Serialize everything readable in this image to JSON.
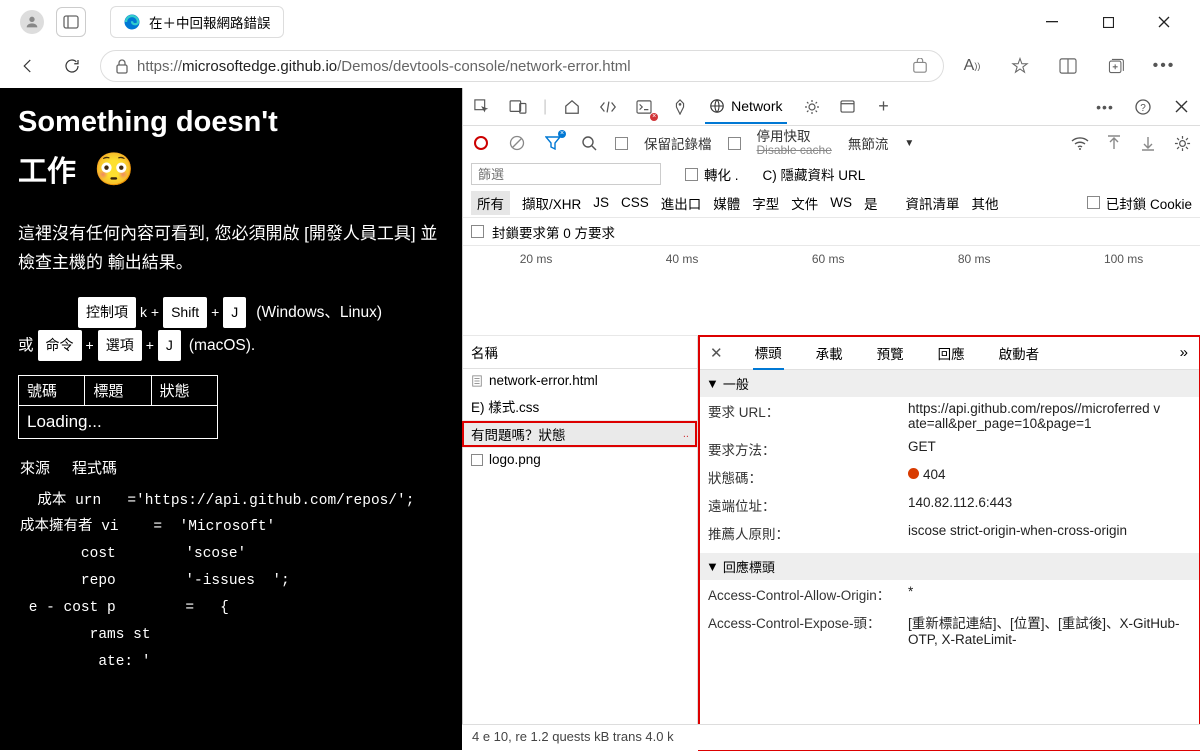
{
  "window": {
    "tab_title": "在＋中回報網路錯誤",
    "url_prefix": "https://",
    "url_host": "microsoftedge.github.io",
    "url_path": "/Demos/devtools-console/network-error.html"
  },
  "page": {
    "h1_line1": "Something doesn't",
    "h1_line2": "工作",
    "emoji": "😳",
    "desc": "這裡沒有任何內容可看到, 您必須開啟 [開發人員工具] 並檢查主機的 輸出結果。",
    "shortcut_keys": {
      "ctrl": "控制項",
      "shift": "Shift",
      "j": "J",
      "win_label": "(Windows、Linux)",
      "or": "或",
      "cmd": "命令",
      "opt": "選項",
      "mac_label": "(macOS)."
    },
    "table": {
      "th1": "號碼",
      "th2": "標題",
      "th3": "狀態",
      "loading": "Loading..."
    },
    "code_head1": "來源",
    "code_head2": "程式碼",
    "code": "  成本 urn   ='https://api.github.com/repos/';\n成本擁有者 vi    =  'Microsoft'\n       cost        'scose'\n       repo        '-issues  ';\n e - cost p        =   {\n        rams st\n         ate: '"
  },
  "devtools": {
    "network_tab": "Network",
    "toolbar2": {
      "preserve_log": "保留記錄檔",
      "disable_cache": "停用快取",
      "disable_strike": "Disable cache",
      "no_throttle": "無節流"
    },
    "filter_placeholder": "篩選",
    "filter_right1": "轉化 .",
    "filter_right2": "C) 隱藏資料 URL",
    "types": [
      "所有",
      "擷取/XHR",
      "JS",
      "CSS",
      "進出口",
      "媒體",
      "字型",
      "文件",
      "WS",
      "是",
      "資訊清單",
      "其他"
    ],
    "blocked_cookies": "已封鎖 Cookie",
    "block_row": "封鎖要求第 0 方要求",
    "timeline_ticks": [
      "20 ms",
      "40 ms",
      "60 ms",
      "80 ms",
      "100 ms"
    ],
    "req_list_header": "名稱",
    "requests": [
      {
        "name": "network-error.html",
        "icon": "doc"
      },
      {
        "name": "E) 樣式.css",
        "icon": "none"
      },
      {
        "name": "有問題嗎？狀態",
        "icon": "none",
        "selected": true,
        "error": ".."
      },
      {
        "name": "logo.png",
        "icon": "img"
      }
    ],
    "details": {
      "tabs": [
        "標頭",
        "承載",
        "預覽",
        "回應",
        "啟動者"
      ],
      "general_hd": "一般",
      "kv": [
        {
          "k": "要求 URL：",
          "v": "https://api.github.com/repos//microferred v\nate=all&per_page=10&page=1"
        },
        {
          "k": "要求方法：",
          "v": "GET"
        },
        {
          "k": "狀態碼：",
          "v": "404",
          "status": true
        },
        {
          "k": "遠端位址：",
          "v": "140.82.112.6:443"
        },
        {
          "k": "推薦人原則：",
          "v": "iscose strict-origin-when-cross-origin"
        }
      ],
      "resp_hd": "回應標頭",
      "resp_kv": [
        {
          "k": "Access-Control-Allow-Origin：",
          "v": "*"
        },
        {
          "k": "Access-Control-Expose-頭：",
          "v": "[重新標記連結]、[位置]、[重試後]、X-GitHub-OTP, X-RateLimit-"
        }
      ]
    },
    "footer": "4 e 10,  re   1.2 quests kB trans  4.0 k"
  }
}
